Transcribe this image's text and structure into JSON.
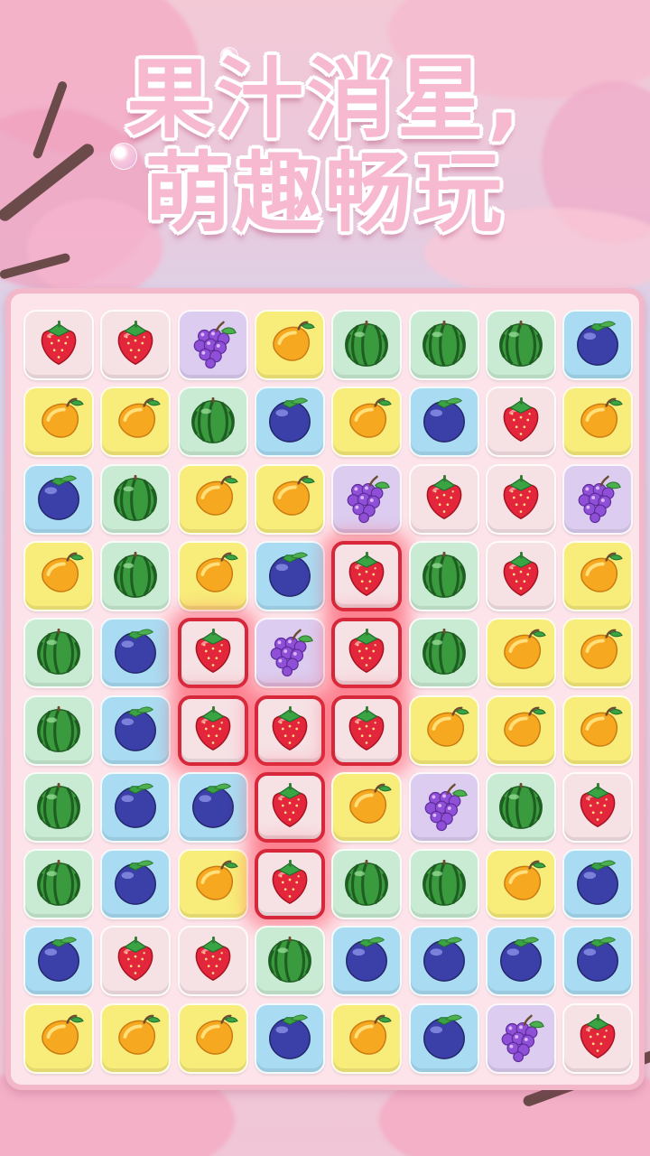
{
  "title": {
    "line1": "果汁消星,",
    "line2": "萌趣畅玩"
  },
  "colors": {
    "strawberry_tile": "#f6e1e5",
    "grape_tile": "#dccdf0",
    "mango_tile": "#f8ec7a",
    "watermelon_tile": "#c9ebd3",
    "blueberry_tile": "#a9dcf2",
    "highlight": "#d6283a"
  },
  "board": {
    "rows": 10,
    "cols": 8,
    "grid": [
      [
        "strawberry",
        "strawberry",
        "grape",
        "mango",
        "watermelon",
        "watermelon",
        "watermelon",
        "blueberry"
      ],
      [
        "mango",
        "mango",
        "watermelon",
        "blueberry",
        "mango",
        "blueberry",
        "strawberry",
        "mango"
      ],
      [
        "blueberry",
        "watermelon",
        "mango",
        "mango",
        "grape",
        "strawberry",
        "strawberry",
        "grape"
      ],
      [
        "mango",
        "watermelon",
        "mango",
        "blueberry",
        "strawberry",
        "watermelon",
        "strawberry",
        "mango"
      ],
      [
        "watermelon",
        "blueberry",
        "strawberry",
        "grape",
        "strawberry",
        "watermelon",
        "mango",
        "mango"
      ],
      [
        "watermelon",
        "blueberry",
        "strawberry",
        "strawberry",
        "strawberry",
        "mango",
        "mango",
        "mango"
      ],
      [
        "watermelon",
        "blueberry",
        "blueberry",
        "strawberry",
        "mango",
        "grape",
        "watermelon",
        "strawberry"
      ],
      [
        "watermelon",
        "blueberry",
        "mango",
        "strawberry",
        "watermelon",
        "watermelon",
        "mango",
        "blueberry"
      ],
      [
        "blueberry",
        "strawberry",
        "strawberry",
        "watermelon",
        "blueberry",
        "blueberry",
        "blueberry",
        "blueberry"
      ],
      [
        "mango",
        "mango",
        "mango",
        "blueberry",
        "mango",
        "blueberry",
        "grape",
        "strawberry"
      ]
    ],
    "highlighted": [
      [
        3,
        4
      ],
      [
        4,
        2
      ],
      [
        4,
        4
      ],
      [
        5,
        2
      ],
      [
        5,
        3
      ],
      [
        5,
        4
      ],
      [
        6,
        3
      ],
      [
        7,
        3
      ]
    ]
  }
}
